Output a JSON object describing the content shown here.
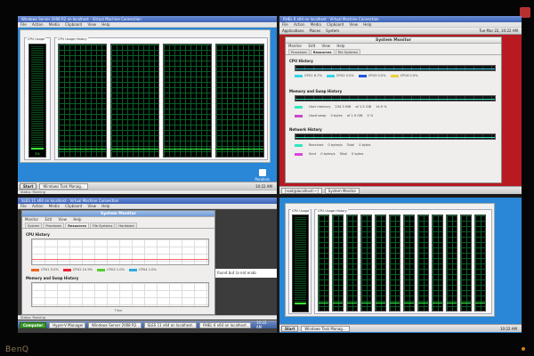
{
  "monitor": {
    "brand": "BenQ"
  },
  "top_left": {
    "title": "Windows Server 2008 R2 on localhost - Virtual Machine Connection",
    "menu": [
      "File",
      "Action",
      "Media",
      "Clipboard",
      "View",
      "Help"
    ],
    "group_cpu": "CPU Usage",
    "group_history": "CPU Usage History",
    "cpu_pct": "2%",
    "watermark": "Parallels",
    "taskbar": {
      "start": "Start",
      "items": [
        "Windows Task Manag..."
      ],
      "clock": "10:22 AM"
    },
    "status": "Status: Running"
  },
  "top_right": {
    "title": "RHEL 6 x64 on localhost - Virtual Machine Connection",
    "menu": [
      "File",
      "Action",
      "Media",
      "Clipboard",
      "View",
      "Help"
    ],
    "panel": [
      "Applications",
      "Places",
      "System"
    ],
    "clock": "Tue Mar 22, 10:22 AM",
    "sm": {
      "title": "System Monitor",
      "menu": [
        "Monitor",
        "Edit",
        "View",
        "Help"
      ],
      "tabs": [
        "Processes",
        "Resources",
        "File Systems"
      ],
      "cpu_title": "CPU History",
      "cpu": [
        {
          "name": "CPU1",
          "value": "6.7%",
          "color": "#33d6e6"
        },
        {
          "name": "CPU2",
          "value": "0.0%",
          "color": "#33d6e6"
        },
        {
          "name": "CPU3",
          "value": "0.0%",
          "color": "#2255dd"
        },
        {
          "name": "CPU4",
          "value": "0.0%",
          "color": "#e8d040"
        }
      ],
      "mem_title": "Memory and Swap History",
      "mem": [
        {
          "label": "User memory",
          "value": "234.3 MiB",
          "of": "of 1.5 GiB",
          "pct": "14.9 %",
          "color": "#33e6c0"
        },
        {
          "label": "Used swap",
          "value": "0 bytes",
          "of": "of 1.9 GiB",
          "pct": "0 %",
          "color": "#cc44cc"
        }
      ],
      "net_title": "Network History",
      "net": [
        {
          "label": "Received",
          "rate": "0 bytes/s",
          "total_label": "Total",
          "total": "0 bytes",
          "color": "#33e6c0"
        },
        {
          "label": "Sent",
          "rate": "0 bytes/s",
          "total_label": "Total",
          "total": "0 bytes",
          "color": "#dd44dd"
        }
      ]
    },
    "taskbar": {
      "items": [
        "[root@localhost:~]",
        "System Monitor"
      ]
    }
  },
  "bottom_left": {
    "title": "SLES 11 x64 on localhost - Virtual Machine Connection",
    "menu": [
      "File",
      "Action",
      "Media",
      "Clipboard",
      "View",
      "Help"
    ],
    "sm": {
      "title": "System Monitor",
      "menu": [
        "Monitor",
        "Edit",
        "View",
        "Help"
      ],
      "tabs": [
        "System",
        "Processes",
        "Resources",
        "File Systems",
        "Hardware"
      ],
      "cpu_title": "CPU History",
      "cpu": [
        {
          "name": "CPU1",
          "value": "0.0%",
          "color": "#ee6622"
        },
        {
          "name": "CPU2",
          "value": "10.9%",
          "color": "#ee2233"
        },
        {
          "name": "CPU3",
          "value": "1.0%",
          "color": "#55cc33"
        },
        {
          "name": "CPU4",
          "value": "1.0%",
          "color": "#33aadd"
        }
      ],
      "mem_title": "Memory and Swap History",
      "x_label": "Time"
    },
    "side_text": "found but (a not enab",
    "taskbar": {
      "start": "Computer",
      "items": [
        "Hyper-V Manager",
        "Windows Server 2008 R2...",
        "SLES 11 x64 on localhost...",
        "RHEL 6 x64 on localhost..."
      ],
      "clock": "10:22 AM"
    },
    "status": "Status: Running"
  },
  "bottom_right": {
    "group_cpu": "CPU Usage",
    "group_history": "CPU Usage History",
    "cpu_count": 12,
    "taskbar": {
      "start": "Start",
      "items": [
        "Windows Task Manag..."
      ],
      "clock": "10:22 AM"
    }
  }
}
